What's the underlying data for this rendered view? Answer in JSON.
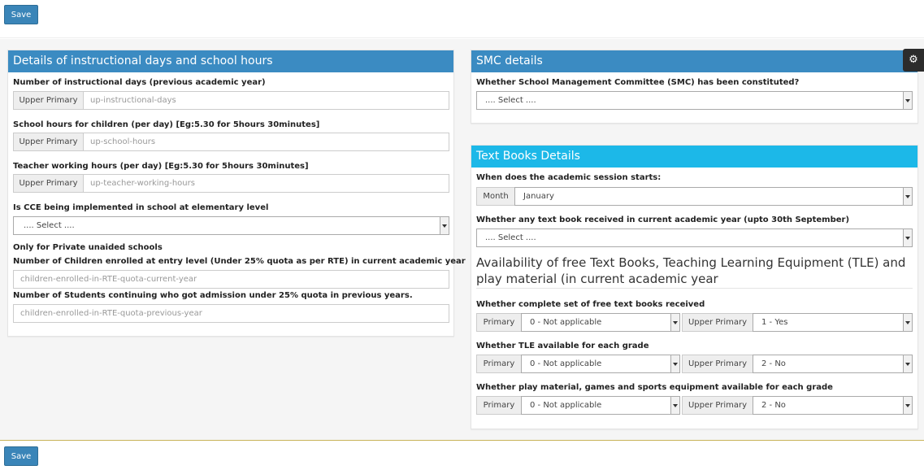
{
  "toolbar": {
    "save_label": "Save"
  },
  "instructional": {
    "title": "Details of instructional days and school hours",
    "days_label": "Number of instructional days (previous academic year)",
    "days_addon": "Upper Primary",
    "days_placeholder": "up-instructional-days",
    "hours_label": "School hours for children (per day) [Eg:5.30 for 5hours 30minutes]",
    "hours_addon": "Upper Primary",
    "hours_placeholder": "up-school-hours",
    "teacher_label": "Teacher working hours (per day) [Eg:5.30 for 5hours 30minutes]",
    "teacher_addon": "Upper Primary",
    "teacher_placeholder": "up-teacher-working-hours",
    "cce_label": "Is CCE being implemented in school at elementary level",
    "cce_value": ".... Select ....",
    "private_label": "Only for Private unaided schools",
    "entry_label": "Number of Children enrolled at entry level (Under 25% quota as per RTE) in current academic year",
    "entry_placeholder": "children-enrolled-in-RTE-quota-current-year",
    "continuing_label": "Number of Students continuing who got admission under 25% quota in previous years.",
    "continuing_placeholder": "children-enrolled-in-RTE-quota-previous-year"
  },
  "smc": {
    "title": "SMC details",
    "label": "Whether School Management Committee (SMC) has been constituted?",
    "value": ".... Select ...."
  },
  "textbooks": {
    "title": "Text Books Details",
    "session_label": "When does the academic session starts:",
    "month_addon": "Month",
    "month_value": "January",
    "received_label": "Whether any text book received in current academic year (upto 30th September)",
    "received_value": ".... Select ....",
    "availability_title": "Availability of free Text Books, Teaching Learning Equipment (TLE) and play material (in current academic year",
    "rows": [
      {
        "label": "Whether complete set of free text books received",
        "primary_addon": "Primary",
        "primary_value": "0 - Not applicable",
        "upper_addon": "Upper Primary",
        "upper_value": "1 - Yes"
      },
      {
        "label": "Whether TLE available for each grade",
        "primary_addon": "Primary",
        "primary_value": "0 - Not applicable",
        "upper_addon": "Upper Primary",
        "upper_value": "2 - No"
      },
      {
        "label": "Whether play material, games and sports equipment available for each grade",
        "primary_addon": "Primary",
        "primary_value": "0 - Not applicable",
        "upper_addon": "Upper Primary",
        "upper_value": "2 - No"
      }
    ]
  },
  "icons": {
    "settings": "gear-icon"
  },
  "colors": {
    "save_button": "#3a85b8",
    "panel_blue": "#3b8bc2",
    "panel_cyan": "#1cb8e8"
  }
}
